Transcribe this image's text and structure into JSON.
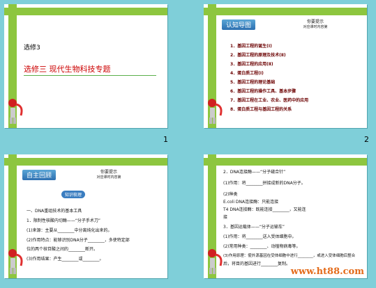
{
  "slides": [
    {
      "number": "1",
      "subtitle": "选修3",
      "title": "选修三 现代生物科技专题"
    },
    {
      "number": "2",
      "header_title": "认知导图",
      "hint_title": "你要提示",
      "hint_sub": "对应课时内容第",
      "items": [
        "1．基因工程的诞生(Ⅰ)",
        "2．基因工程的原理及技术(Ⅱ)",
        "3．基因工程的应用(Ⅱ)",
        "4．蛋白质工程(Ⅰ)",
        "5．基因工程的理论基础",
        "6．基因工程的操作工具、基本步骤",
        "7．基因工程在工业、农业、医药中的应用",
        "8．蛋白质工程与基因工程的关系"
      ]
    },
    {
      "number": "",
      "header_title": "自主回顾",
      "hint_title": "你要提示",
      "hint_sub": "对应课时内容第",
      "badge": "知识梳理",
      "lines": [
        "一、DNA重组技术的基本工具",
        "1．限制性核酸内切酶——“分子手术刀”",
        "(1)来源：主要从________中分离纯化出来的。",
        "(2)作用特点：能够识别DNA分子________，多使特定部",
        "位的两个核苷酸之间的________断开。",
        "(3)作用结果：产生________或________。"
      ]
    },
    {
      "number": "",
      "lines": [
        "2．DNA连接酶——“分子缝合针”",
        "(1)作用：将________拼接成新的DNA分子。",
        "(2)种类",
        "E.coli DNA连接酶：只能连接",
        "T4 DNA连接酶：既能连接________，又能连",
        "接",
        "3．基因运载体——“分子运输车”",
        "(1)作用：将________送入受体细胞中。",
        "(2)常用种类：________、动植物病毒等。",
        "(3)作用原理：使外源基因在受体细胞中进行________，或进入受体细胞后整合",
        "后，将目的基因进行________复制。"
      ],
      "watermark": "www.ht88.com"
    }
  ]
}
